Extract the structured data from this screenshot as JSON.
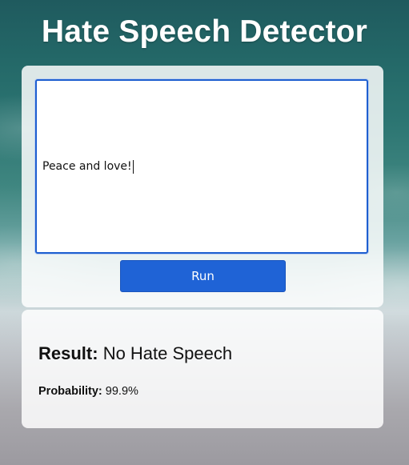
{
  "app": {
    "title": "Hate Speech Detector"
  },
  "input": {
    "value": "Peace and love!"
  },
  "actions": {
    "run_label": "Run"
  },
  "result": {
    "label": "Result:",
    "value": "No Hate Speech",
    "probability_label": "Probability:",
    "probability_value": "99.9%"
  },
  "colors": {
    "button": "#1f63d6",
    "focus_border": "#1e5fd0",
    "title_text": "#ffffff"
  }
}
